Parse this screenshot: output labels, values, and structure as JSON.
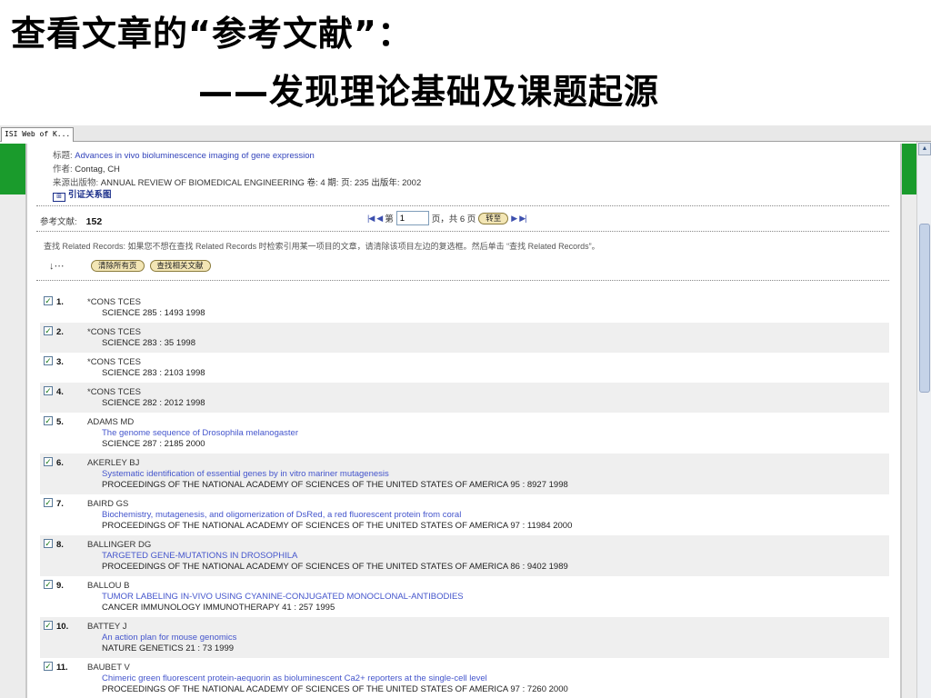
{
  "slide": {
    "title": "查看文章的“参考文献”：",
    "subtitle": "——发现理论基础及课题起源"
  },
  "browser": {
    "tab_label": "ISI Web of K..."
  },
  "article": {
    "title_label": "标题:",
    "title_value": "Advances in vivo bioluminescence imaging of gene expression",
    "author_label": "作者:",
    "author_value": "Contag, CH",
    "source_label": "来源出版物:",
    "source_value": "ANNUAL REVIEW OF BIOMEDICAL ENGINEERING 卷: 4 期: 页: 235 出版年: 2002",
    "cite_map_label": "引证关系图",
    "cite_map_icon": "cite-map-icon"
  },
  "refs": {
    "label": "参考文献:",
    "count": "152",
    "page_prefix": "第",
    "page_value": "1",
    "page_suffix": "页，共 6 页",
    "goto_label": "转至",
    "first_icon": "first-page-icon",
    "prev_icon": "prev-page-icon",
    "next_icon": "next-page-icon",
    "last_icon": "last-page-icon",
    "help_text": "查找 Related Records: 如果您不想在查找 Related Records 时检索引用某一项目的文章，请清除该项目左边的复选框。然后单击 “查找 Related Records”。",
    "clear_all_label": "清除所有页",
    "find_related_label": "查找相关文献"
  },
  "records": [
    {
      "num": "1.",
      "author": "*CONS TCES",
      "title": "",
      "source": "SCIENCE 285 : 1493 1998",
      "checked": true
    },
    {
      "num": "2.",
      "author": "*CONS TCES",
      "title": "",
      "source": "SCIENCE 283 : 35 1998",
      "checked": true
    },
    {
      "num": "3.",
      "author": "*CONS TCES",
      "title": "",
      "source": "SCIENCE 283 : 2103 1998",
      "checked": true
    },
    {
      "num": "4.",
      "author": "*CONS TCES",
      "title": "",
      "source": "SCIENCE 282 : 2012 1998",
      "checked": true
    },
    {
      "num": "5.",
      "author": "ADAMS MD",
      "title": "The genome sequence of Drosophila melanogaster",
      "source": "SCIENCE 287 : 2185 2000",
      "checked": true
    },
    {
      "num": "6.",
      "author": "AKERLEY BJ",
      "title": "Systematic identification of essential genes by in vitro mariner mutagenesis",
      "source": "PROCEEDINGS OF THE NATIONAL ACADEMY OF SCIENCES OF THE UNITED STATES OF AMERICA 95 : 8927 1998",
      "checked": true
    },
    {
      "num": "7.",
      "author": "BAIRD GS",
      "title": "Biochemistry, mutagenesis, and oligomerization of DsRed, a red fluorescent protein from coral",
      "source": "PROCEEDINGS OF THE NATIONAL ACADEMY OF SCIENCES OF THE UNITED STATES OF AMERICA 97 : 11984 2000",
      "checked": true
    },
    {
      "num": "8.",
      "author": "BALLINGER DG",
      "title": "TARGETED GENE-MUTATIONS IN DROSOPHILA",
      "source": "PROCEEDINGS OF THE NATIONAL ACADEMY OF SCIENCES OF THE UNITED STATES OF AMERICA 86 : 9402 1989",
      "checked": true
    },
    {
      "num": "9.",
      "author": "BALLOU B",
      "title": "TUMOR LABELING IN-VIVO USING CYANINE-CONJUGATED MONOCLONAL-ANTIBODIES",
      "source": "CANCER IMMUNOLOGY IMMUNOTHERAPY 41 : 257 1995",
      "checked": true
    },
    {
      "num": "10.",
      "author": "BATTEY J",
      "title": "An action plan for mouse genomics",
      "source": "NATURE GENETICS 21 : 73 1999",
      "checked": true
    },
    {
      "num": "11.",
      "author": "BAUBET V",
      "title": "Chimeric green fluorescent protein-aequorin as bioluminescent Ca2+ reporters at the single-cell level",
      "source": "PROCEEDINGS OF THE NATIONAL ACADEMY OF SCIENCES OF THE UNITED STATES OF AMERICA 97 : 7260 2000",
      "checked": true
    }
  ],
  "colors": {
    "accent_green": "#1a9b2c",
    "link_blue": "#4455cc",
    "button_fill": "#f3e6b5"
  }
}
